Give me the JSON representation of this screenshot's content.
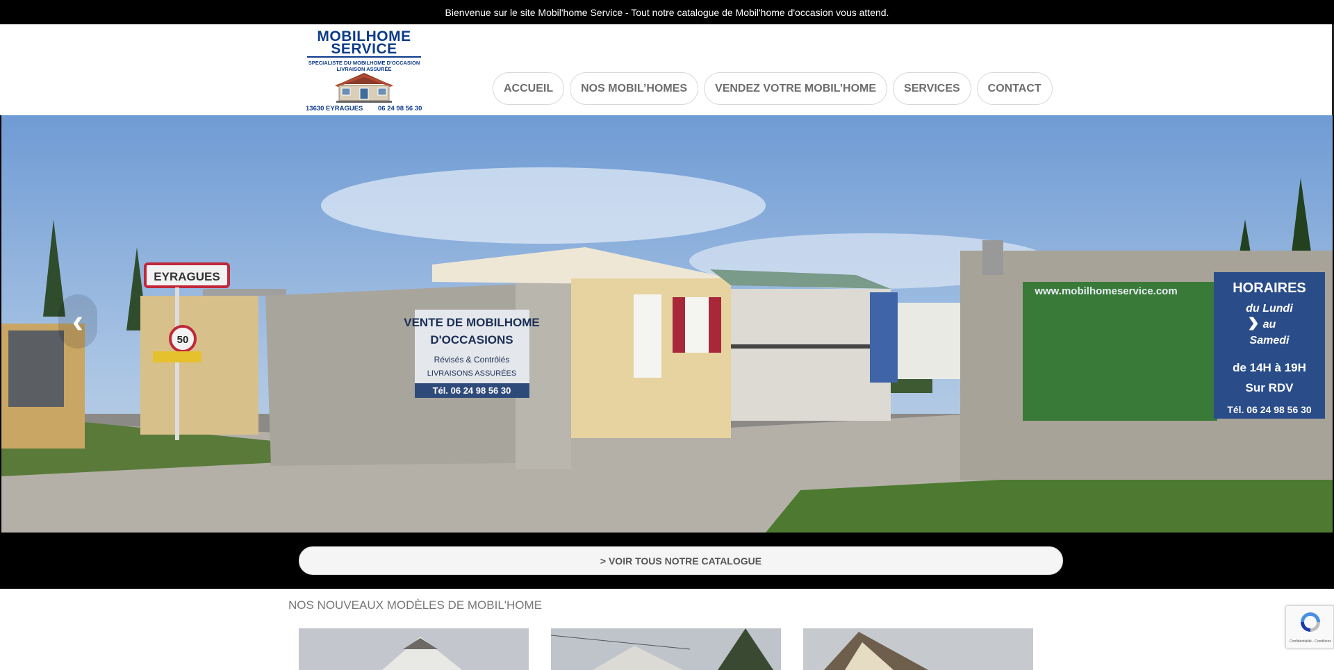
{
  "topbar": {
    "message": "Bienvenue sur le site Mobil'home Service - Tout notre catalogue de Mobil'home d'occasion vous attend."
  },
  "logo": {
    "line1": "MOBILHOME",
    "line2": "SERVICE",
    "tagline1": "SPECIALISTE DU MOBILHOME D'OCCASION",
    "tagline2": "LIVRAISON ASSURÉE",
    "location": "13630 EYRAGUES",
    "phone": "06 24 98 56 30"
  },
  "nav": {
    "items": [
      {
        "label": "ACCUEIL"
      },
      {
        "label": "NOS MOBIL’HOMES"
      },
      {
        "label": "VENDEZ VOTRE MOBIL’HOME"
      },
      {
        "label": "SERVICES"
      },
      {
        "label": "CONTACT"
      }
    ]
  },
  "hero": {
    "town_sign": "EYRAGUES",
    "speed_sign": "50",
    "wall_sign": {
      "line1": "VENTE DE MOBILHOME",
      "line2": "D'OCCASIONS",
      "line3": "Révisés & Contrôlés",
      "line4": "LIVRAISONS ASSURÉES",
      "phone": "Tél. 06 24 98 56 30"
    },
    "banner": {
      "url": "www.mobilhomeservice.com",
      "title": "HORAIRES",
      "line1": "du Lundi",
      "line2": "au",
      "line3": "Samedi",
      "line4": "de 14H à 19H",
      "line5": "Sur RDV",
      "phone": "Tél. 06 24 98 56 30"
    },
    "prev_icon": "chevron-left-icon",
    "next_icon": "chevron-right-icon"
  },
  "catalog_button": {
    "label": "> VOIR TOUS NOTRE CATALOGUE"
  },
  "section": {
    "title": "NOS NOUVEAUX MODÈLES DE MOBIL'HOME"
  },
  "recaptcha": {
    "text": "Confidentialité - Conditions"
  },
  "colors": {
    "brand_blue": "#0d3b8a",
    "topbar": "#000000",
    "nav_text": "#6d6d6d"
  }
}
